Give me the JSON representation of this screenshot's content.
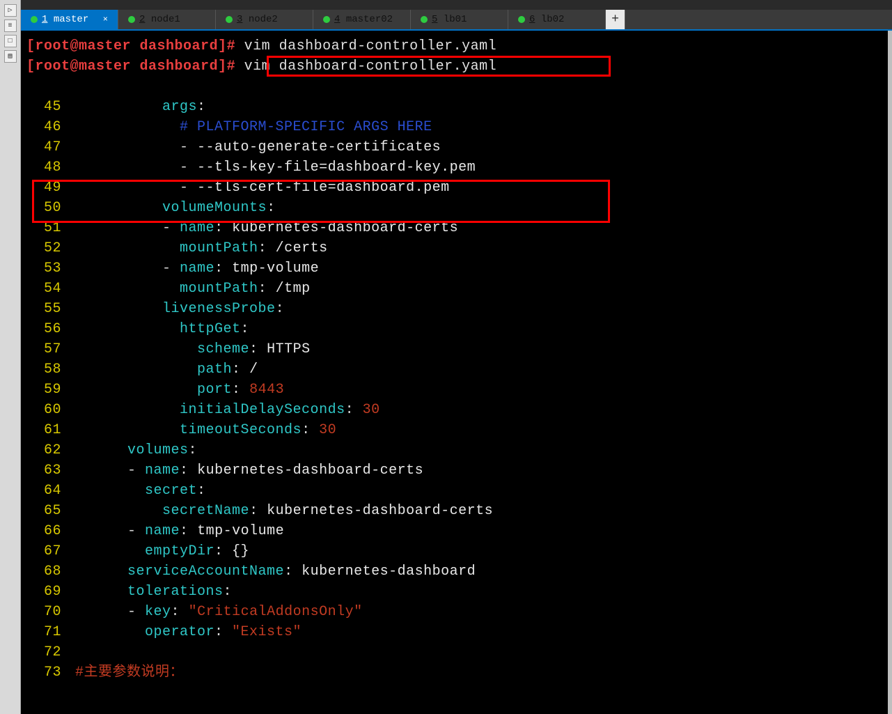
{
  "tabs": [
    {
      "num": "1",
      "label": "master",
      "active": true,
      "closable": true
    },
    {
      "num": "2",
      "label": "node1",
      "active": false
    },
    {
      "num": "3",
      "label": "node2",
      "active": false
    },
    {
      "num": "4",
      "label": "master02",
      "active": false
    },
    {
      "num": "5",
      "label": "lb01",
      "active": false
    },
    {
      "num": "6",
      "label": "lb02",
      "active": false
    }
  ],
  "newtab": "+",
  "prompt": {
    "user_host": "[root@master",
    "dir": "dashboard",
    "end": "]#",
    "cmd1": "vim dashboard-controller.yaml",
    "cmd2": "vim dashboard-controller.yaml"
  },
  "code": {
    "l45": {
      "n": "45",
      "i": "          ",
      "k": "args",
      "c": ":"
    },
    "l46": {
      "n": "46",
      "i": "            ",
      "cm": "# PLATFORM-SPECIFIC ARGS HERE"
    },
    "l47": {
      "n": "47",
      "i": "            ",
      "d": "- ",
      "v": "--auto-generate-certificates"
    },
    "l48": {
      "n": "48",
      "i": "            ",
      "d": "- ",
      "v": "--tls-key-file=dashboard-key.pem"
    },
    "l49": {
      "n": "49",
      "i": "            ",
      "d": "- ",
      "v": "--tls-cert-file=dashboard.pem"
    },
    "l50": {
      "n": "50",
      "i": "          ",
      "k": "volumeMounts",
      "c": ":"
    },
    "l51": {
      "n": "51",
      "i": "          ",
      "d": "- ",
      "k": "name",
      "c": ": ",
      "v": "kubernetes-dashboard-certs"
    },
    "l52": {
      "n": "52",
      "i": "            ",
      "k": "mountPath",
      "c": ": ",
      "v": "/certs"
    },
    "l53": {
      "n": "53",
      "i": "          ",
      "d": "- ",
      "k": "name",
      "c": ": ",
      "v": "tmp-volume"
    },
    "l54": {
      "n": "54",
      "i": "            ",
      "k": "mountPath",
      "c": ": ",
      "v": "/tmp"
    },
    "l55": {
      "n": "55",
      "i": "          ",
      "k": "livenessProbe",
      "c": ":"
    },
    "l56": {
      "n": "56",
      "i": "            ",
      "k": "httpGet",
      "c": ":"
    },
    "l57": {
      "n": "57",
      "i": "              ",
      "k": "scheme",
      "c": ": ",
      "v": "HTTPS"
    },
    "l58": {
      "n": "58",
      "i": "              ",
      "k": "path",
      "c": ": ",
      "v": "/"
    },
    "l59": {
      "n": "59",
      "i": "              ",
      "k": "port",
      "c": ": ",
      "r": "8443"
    },
    "l60": {
      "n": "60",
      "i": "            ",
      "k": "initialDelaySeconds",
      "c": ": ",
      "r": "30"
    },
    "l61": {
      "n": "61",
      "i": "            ",
      "k": "timeoutSeconds",
      "c": ": ",
      "r": "30"
    },
    "l62": {
      "n": "62",
      "i": "      ",
      "k": "volumes",
      "c": ":"
    },
    "l63": {
      "n": "63",
      "i": "      ",
      "d": "- ",
      "k": "name",
      "c": ": ",
      "v": "kubernetes-dashboard-certs"
    },
    "l64": {
      "n": "64",
      "i": "        ",
      "k": "secret",
      "c": ":"
    },
    "l65": {
      "n": "65",
      "i": "          ",
      "k": "secretName",
      "c": ": ",
      "v": "kubernetes-dashboard-certs"
    },
    "l66": {
      "n": "66",
      "i": "      ",
      "d": "- ",
      "k": "name",
      "c": ": ",
      "v": "tmp-volume"
    },
    "l67": {
      "n": "67",
      "i": "        ",
      "k": "emptyDir",
      "c": ": ",
      "v": "{}"
    },
    "l68": {
      "n": "68",
      "i": "      ",
      "k": "serviceAccountName",
      "c": ": ",
      "v": "kubernetes-dashboard"
    },
    "l69": {
      "n": "69",
      "i": "      ",
      "k": "tolerations",
      "c": ":"
    },
    "l70": {
      "n": "70",
      "i": "      ",
      "d": "- ",
      "k": "key",
      "c": ": ",
      "s": "\"CriticalAddonsOnly\""
    },
    "l71": {
      "n": "71",
      "i": "        ",
      "k": "operator",
      "c": ": ",
      "s": "\"Exists\""
    },
    "l72": {
      "n": "72"
    },
    "l73": {
      "n": "73",
      "cc": "#主要参数说明："
    }
  },
  "sidebar": {
    "b1": "▷",
    "b2": "≡",
    "b3": "□",
    "b4": "▤"
  }
}
